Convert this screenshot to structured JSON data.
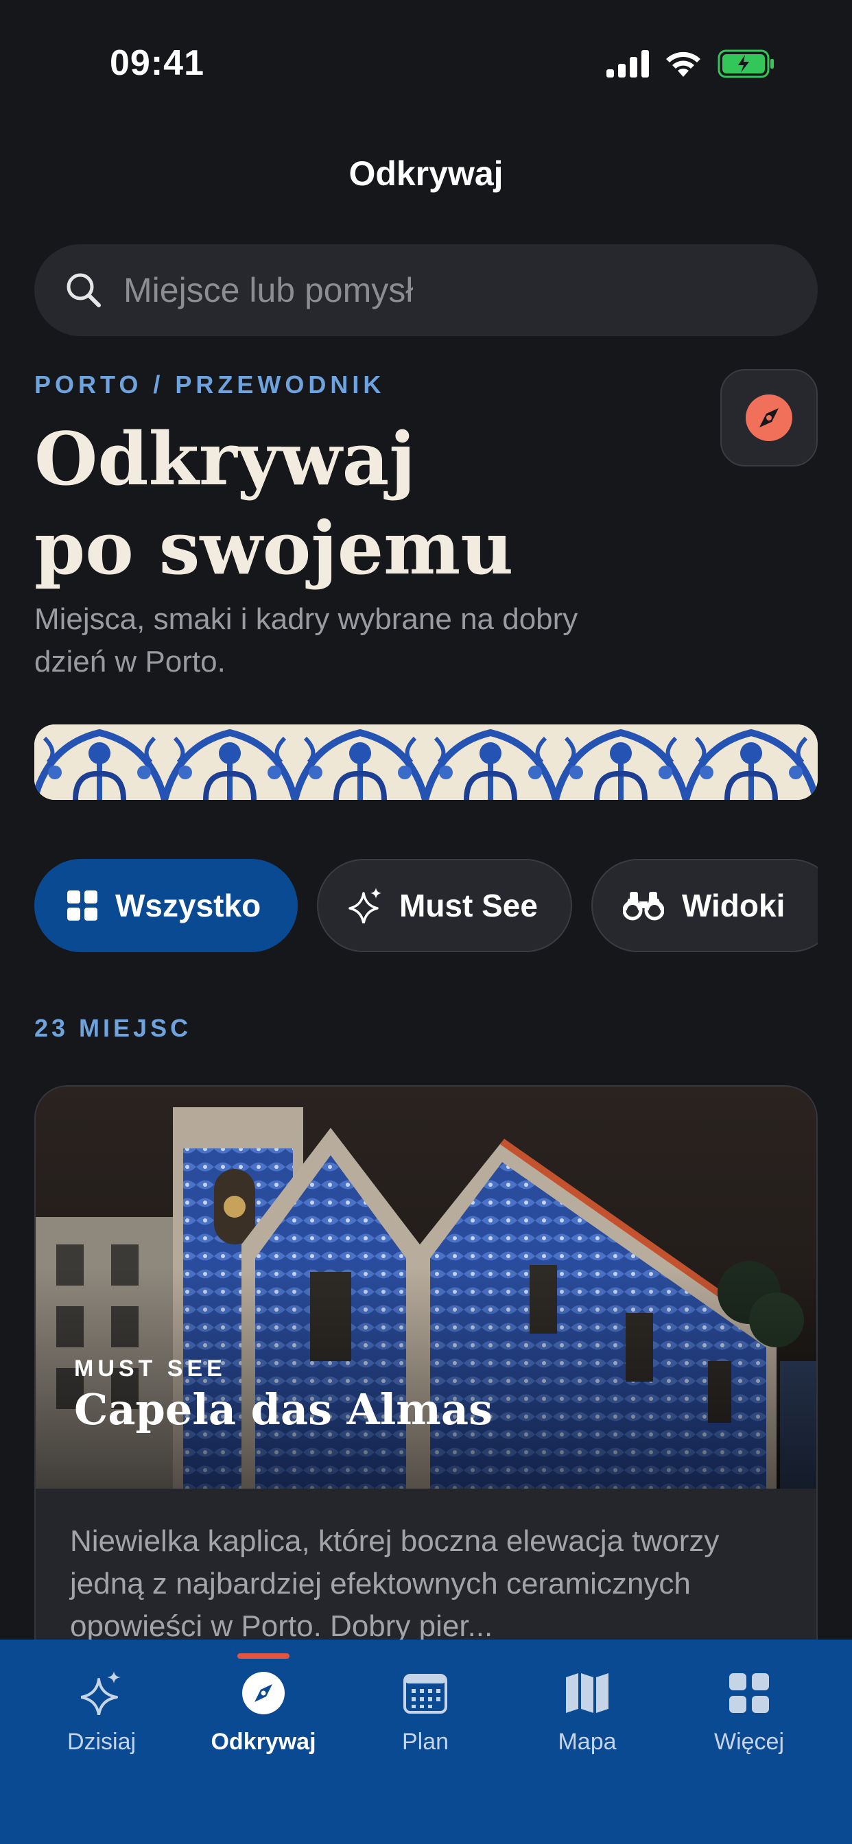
{
  "status_bar": {
    "time": "09:41"
  },
  "nav": {
    "title": "Odkrywaj"
  },
  "search": {
    "placeholder": "Miejsce lub pomysł"
  },
  "hero": {
    "eyebrow": "PORTO / PRZEWODNIK",
    "title_line1": "Odkrywaj",
    "title_line2": "po swojemu",
    "subtitle": "Miejsca, smaki i kadry wybrane na dobry dzień w Porto.",
    "compass_icon": "compass-icon"
  },
  "filters": [
    {
      "label": "Wszystko",
      "icon": "grid-icon",
      "selected": true
    },
    {
      "label": "Must See",
      "icon": "sparkles-icon",
      "selected": false
    },
    {
      "label": "Widoki",
      "icon": "binoculars-icon",
      "selected": false
    }
  ],
  "results": {
    "count_label": "23 MIEJSC"
  },
  "cards": [
    {
      "tag": "MUST SEE",
      "title": "Capela das Almas",
      "description": "Niewielka kaplica, której boczna elewacja tworzy jedną z najbardziej efektownych ceramicznych opowieści w Porto. Dobry pier..."
    }
  ],
  "tabs": [
    {
      "label": "Dzisiaj",
      "icon": "sparkles-icon",
      "active": false
    },
    {
      "label": "Odkrywaj",
      "icon": "compass-icon",
      "active": true
    },
    {
      "label": "Plan",
      "icon": "calendar-icon",
      "active": false
    },
    {
      "label": "Mapa",
      "icon": "map-icon",
      "active": false
    },
    {
      "label": "Więcej",
      "icon": "grid-icon",
      "active": false
    }
  ],
  "colors": {
    "background": "#16171b",
    "accent_blue": "#0a4a92",
    "eyebrow_blue": "#6ea3de",
    "accent_coral": "#f0705a",
    "hero_cream": "#f2ece0",
    "battery_green": "#33c75a"
  }
}
